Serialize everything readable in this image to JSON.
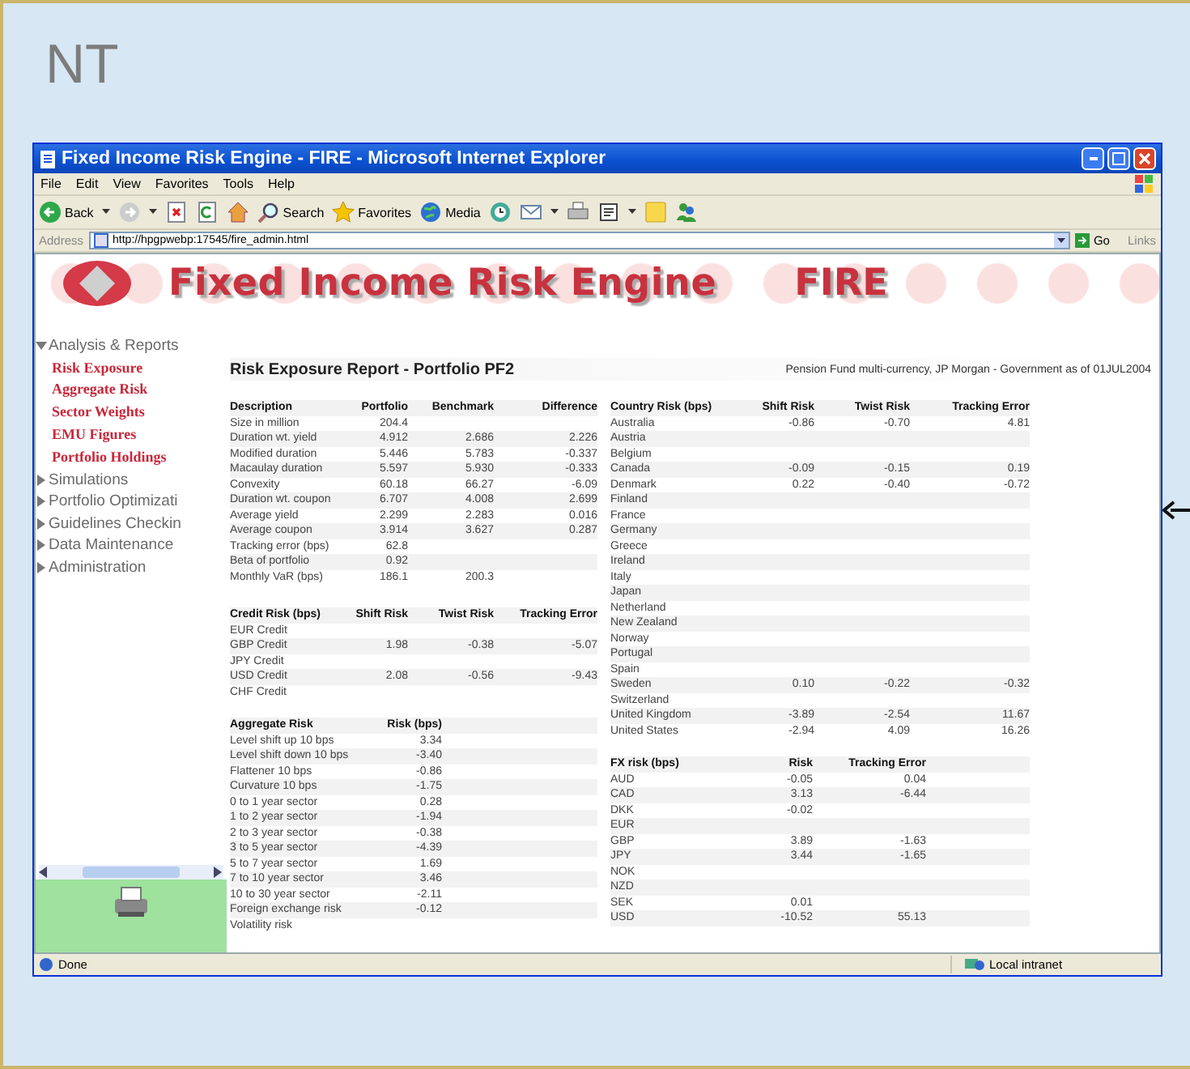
{
  "slide": {
    "title": "NT"
  },
  "window": {
    "title": "Fixed Income Risk Engine - FIRE - Microsoft Internet Explorer",
    "menu": [
      "File",
      "Edit",
      "View",
      "Favorites",
      "Tools",
      "Help"
    ],
    "toolbar": [
      {
        "kind": "back",
        "label": "Back",
        "dropdown": true
      },
      {
        "kind": "forward",
        "dropdown": true
      },
      {
        "kind": "stop"
      },
      {
        "kind": "refresh"
      },
      {
        "kind": "home"
      },
      {
        "kind": "search",
        "label": "Search"
      },
      {
        "kind": "favorites",
        "label": "Favorites"
      },
      {
        "kind": "media",
        "label": "Media"
      },
      {
        "kind": "history"
      },
      {
        "kind": "mail",
        "dropdown": true
      },
      {
        "kind": "print"
      },
      {
        "kind": "edit",
        "dropdown": true
      },
      {
        "kind": "notes"
      },
      {
        "kind": "messenger"
      }
    ],
    "address": {
      "label": "Address",
      "url": "http://hpgpwebp:17545/fire_admin.html",
      "go": "Go",
      "links": "Links"
    },
    "status": {
      "text": "Done",
      "zone": "Local intranet"
    }
  },
  "banner": {
    "title": "Fixed Income Risk Engine",
    "acronym": "FIRE"
  },
  "sidebar": {
    "items": [
      {
        "label": "Analysis & Reports",
        "expanded": true,
        "children": [
          {
            "label": "Risk Exposure"
          },
          {
            "label": "Aggregate Risk"
          },
          {
            "label": "Sector Weights"
          },
          {
            "label": "EMU Figures"
          },
          {
            "label": "Portfolio Holdings"
          }
        ]
      },
      {
        "label": "Simulations",
        "expanded": false
      },
      {
        "label": "Portfolio Optimizati",
        "expanded": false
      },
      {
        "label": "Guidelines Checkin",
        "expanded": false
      },
      {
        "label": "Data Maintenance",
        "expanded": false
      },
      {
        "label": "Administration",
        "expanded": false
      }
    ]
  },
  "report": {
    "title": "Risk Exposure Report - Portfolio PF2",
    "subtitle": "Pension Fund multi-currency, JP Morgan - Government as of 01JUL2004",
    "description": {
      "columns": [
        "Description",
        "Portfolio",
        "Benchmark",
        "Difference"
      ],
      "rows": [
        {
          "label": "Size in million",
          "values": [
            "204.4"
          ]
        },
        {
          "label": "Duration wt. yield",
          "values": [
            "4.912",
            "2.686",
            "2.226"
          ]
        },
        {
          "label": "Modified duration",
          "values": [
            "5.446",
            "5.783",
            "-0.337"
          ]
        },
        {
          "label": "Macaulay duration",
          "values": [
            "5.597",
            "5.930",
            "-0.333"
          ]
        },
        {
          "label": "Convexity",
          "values": [
            "60.18",
            "66.27",
            "-6.09"
          ]
        },
        {
          "label": "Duration wt. coupon",
          "values": [
            "6.707",
            "4.008",
            "2.699"
          ]
        },
        {
          "label": "Average yield",
          "values": [
            "2.299",
            "2.283",
            "0.016"
          ]
        },
        {
          "label": "Average coupon",
          "values": [
            "3.914",
            "3.627",
            "0.287"
          ]
        },
        {
          "label": "Tracking error (bps)",
          "values": [
            "62.8"
          ]
        },
        {
          "label": "Beta of portfolio",
          "values": [
            "0.92"
          ]
        },
        {
          "label": "Monthly VaR (bps)",
          "values": [
            "186.1",
            "200.3"
          ]
        }
      ]
    },
    "credit": {
      "columns": [
        "Credit Risk (bps)",
        "Shift Risk",
        "Twist Risk",
        "Tracking Error"
      ],
      "rows": [
        {
          "label": "EUR Credit"
        },
        {
          "label": "GBP Credit",
          "values": [
            "1.98",
            "-0.38",
            "-5.07"
          ]
        },
        {
          "label": "JPY Credit"
        },
        {
          "label": "USD Credit",
          "values": [
            "2.08",
            "-0.56",
            "-9.43"
          ]
        },
        {
          "label": "CHF Credit"
        }
      ]
    },
    "aggregate": {
      "columns": [
        "Aggregate Risk",
        "Risk (bps)"
      ],
      "rows": [
        {
          "label": "Level shift up 10 bps",
          "values": [
            "3.34"
          ]
        },
        {
          "label": "Level shift down 10 bps",
          "values": [
            "-3.40"
          ]
        },
        {
          "label": "Flattener 10 bps",
          "values": [
            "-0.86"
          ]
        },
        {
          "label": "Curvature 10 bps",
          "values": [
            "-1.75"
          ]
        },
        {
          "label": "0 to 1 year sector",
          "values": [
            "0.28"
          ]
        },
        {
          "label": "1 to 2 year sector",
          "values": [
            "-1.94"
          ]
        },
        {
          "label": "2 to 3 year sector",
          "values": [
            "-0.38"
          ]
        },
        {
          "label": "3 to 5 year sector",
          "values": [
            "-4.39"
          ]
        },
        {
          "label": "5 to 7 year sector",
          "values": [
            "1.69"
          ]
        },
        {
          "label": "7 to 10 year sector",
          "values": [
            "3.46"
          ]
        },
        {
          "label": "10 to 30 year sector",
          "values": [
            "-2.11"
          ]
        },
        {
          "label": "Foreign exchange risk",
          "values": [
            "-0.12"
          ]
        },
        {
          "label": "Volatility risk"
        }
      ]
    },
    "country": {
      "columns": [
        "Country Risk (bps)",
        "Shift Risk",
        "Twist Risk",
        "Tracking Error"
      ],
      "rows": [
        {
          "label": "Australia",
          "values": [
            "-0.86",
            "-0.70",
            "4.81"
          ]
        },
        {
          "label": "Austria"
        },
        {
          "label": "Belgium"
        },
        {
          "label": "Canada",
          "values": [
            "-0.09",
            "-0.15",
            "0.19"
          ]
        },
        {
          "label": "Denmark",
          "values": [
            "0.22",
            "-0.40",
            "-0.72"
          ]
        },
        {
          "label": "Finland"
        },
        {
          "label": "France"
        },
        {
          "label": "Germany"
        },
        {
          "label": "Greece"
        },
        {
          "label": "Ireland"
        },
        {
          "label": "Italy"
        },
        {
          "label": "Japan"
        },
        {
          "label": "Netherland"
        },
        {
          "label": "New Zealand"
        },
        {
          "label": "Norway"
        },
        {
          "label": "Portugal"
        },
        {
          "label": "Spain"
        },
        {
          "label": "Sweden",
          "values": [
            "0.10",
            "-0.22",
            "-0.32"
          ]
        },
        {
          "label": "Switzerland"
        },
        {
          "label": "United Kingdom",
          "values": [
            "-3.89",
            "-2.54",
            "11.67"
          ]
        },
        {
          "label": "United States",
          "values": [
            "-2.94",
            "4.09",
            "16.26"
          ]
        }
      ]
    },
    "fx": {
      "columns": [
        "FX risk (bps)",
        "Risk",
        "Tracking Error"
      ],
      "rows": [
        {
          "label": "AUD",
          "values": [
            "-0.05",
            "0.04"
          ]
        },
        {
          "label": "CAD",
          "values": [
            "3.13",
            "-6.44"
          ]
        },
        {
          "label": "DKK",
          "values": [
            "-0.02"
          ]
        },
        {
          "label": "EUR"
        },
        {
          "label": "GBP",
          "values": [
            "3.89",
            "-1.63"
          ]
        },
        {
          "label": "JPY",
          "values": [
            "3.44",
            "-1.65"
          ]
        },
        {
          "label": "NOK"
        },
        {
          "label": "NZD"
        },
        {
          "label": "SEK",
          "values": [
            "0.01"
          ]
        },
        {
          "label": "USD",
          "values": [
            "-10.52",
            "55.13"
          ]
        }
      ]
    }
  }
}
